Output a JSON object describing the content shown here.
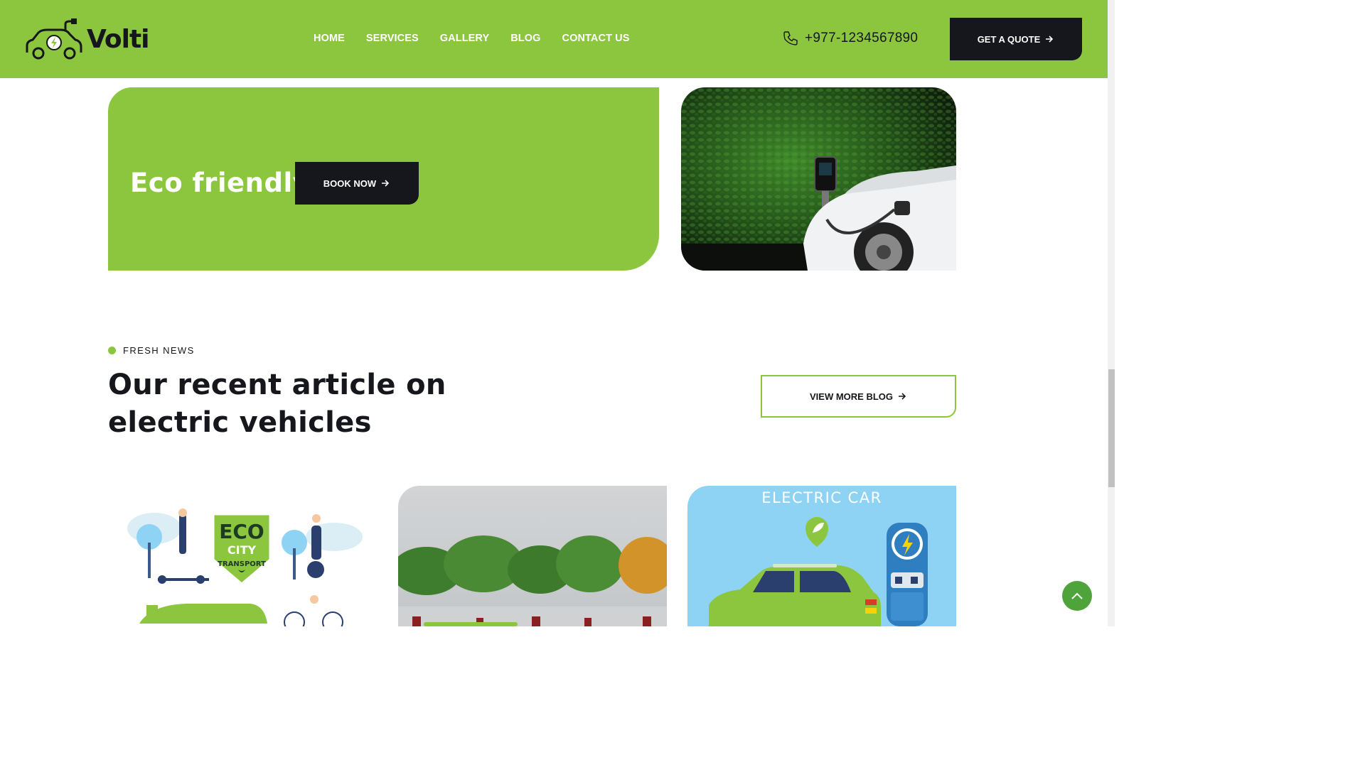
{
  "header": {
    "logo_text": "Volti",
    "nav": [
      "HOME",
      "SERVICES",
      "GALLERY",
      "BLOG",
      "CONTACT US"
    ],
    "phone": "+977-1234567890",
    "quote_label": "GET A QUOTE"
  },
  "banner": {
    "title": "Eco friendly",
    "book_label": "BOOK NOW"
  },
  "news": {
    "kicker": "FRESH NEWS",
    "title": "Our recent article on electric vehicles",
    "more_label": "VIEW MORE BLOG",
    "cards": [
      {
        "badge_line1": "ECO",
        "badge_line2": "CITY",
        "badge_line3": "TRANSPORT"
      },
      {},
      {
        "title": "ELECTRIC CAR"
      }
    ]
  },
  "colors": {
    "accent": "#8cc63f",
    "dark": "#15171c",
    "sky": "#8fd3f4"
  },
  "icons": [
    "car-plug-logo-icon",
    "phone-icon",
    "arrow-right-icon",
    "chevron-up-icon",
    "lightning-icon",
    "leaf-icon"
  ]
}
